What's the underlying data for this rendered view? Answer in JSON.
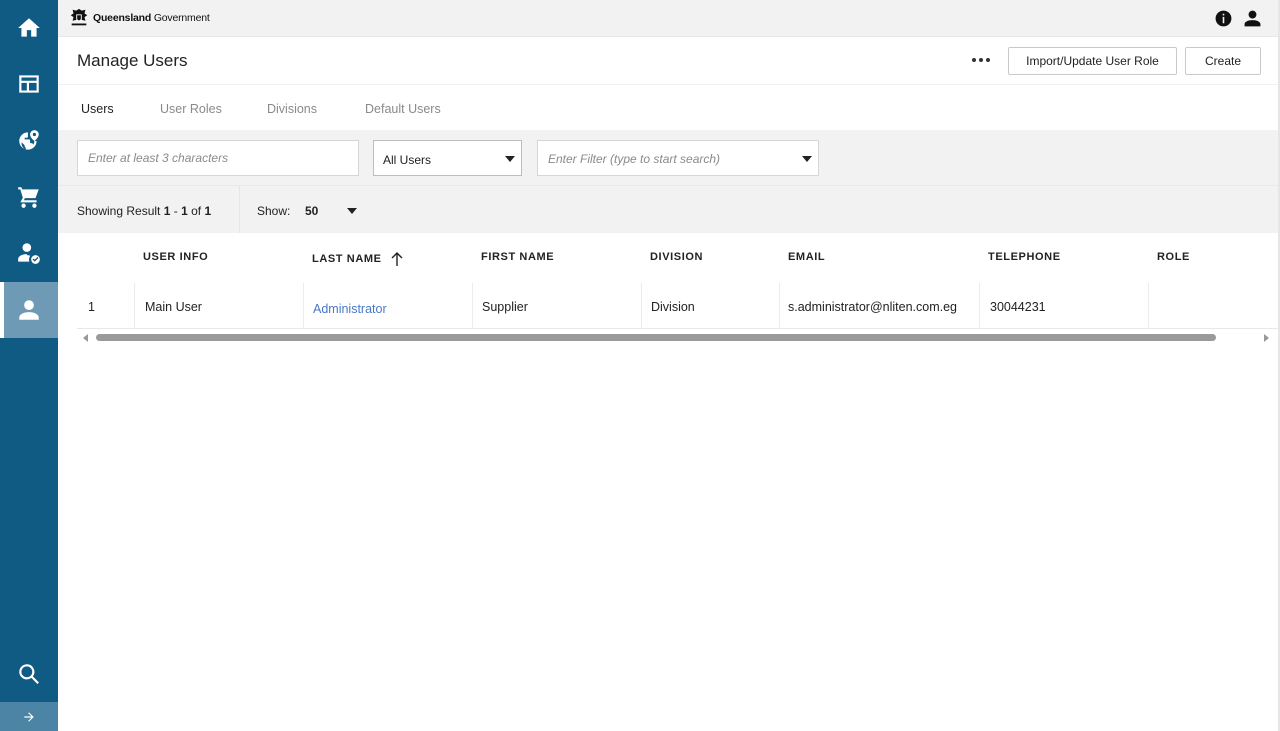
{
  "brand": {
    "name_bold": "Queensland",
    "name_rest": " Government"
  },
  "topbar": {
    "icons": [
      "info-icon",
      "user-icon"
    ]
  },
  "sidebar": {
    "items": [
      {
        "icon": "home-icon"
      },
      {
        "icon": "dashboard-icon"
      },
      {
        "icon": "globe-icon"
      },
      {
        "icon": "cart-icon"
      },
      {
        "icon": "user-check-icon"
      },
      {
        "icon": "user-icon",
        "active": true
      },
      {
        "icon": "search-icon"
      }
    ],
    "expand_icon": "arrow-right-icon"
  },
  "header": {
    "title": "Manage Users",
    "more_icon": "more-dots-icon",
    "import_label": "Import/Update User Role",
    "create_label": "Create"
  },
  "tabs": [
    {
      "label": "Users",
      "active": true
    },
    {
      "label": "User Roles"
    },
    {
      "label": "Divisions"
    },
    {
      "label": "Default Users"
    }
  ],
  "filters": {
    "search_placeholder": "Enter at least 3 characters",
    "user_select_value": "All Users",
    "filter_placeholder": "Enter Filter (type to start search)"
  },
  "results": {
    "prefix": "Showing Result ",
    "from": "1",
    "sep": " - ",
    "to": "1",
    "of": " of ",
    "total": "1",
    "show_label": "Show:",
    "show_value": "50"
  },
  "table": {
    "columns": [
      "USER INFO",
      "LAST NAME",
      "FIRST NAME",
      "DIVISION",
      "EMAIL",
      "TELEPHONE",
      "ROLE"
    ],
    "sort_icon": "arrow-up-icon",
    "rows": [
      {
        "index": "1",
        "user_info": "Main User",
        "last_name": "Administrator",
        "first_name": "Supplier",
        "division": "Division",
        "email": "s.administrator@nliten.com.eg",
        "telephone": "30044231",
        "role": ""
      }
    ]
  }
}
